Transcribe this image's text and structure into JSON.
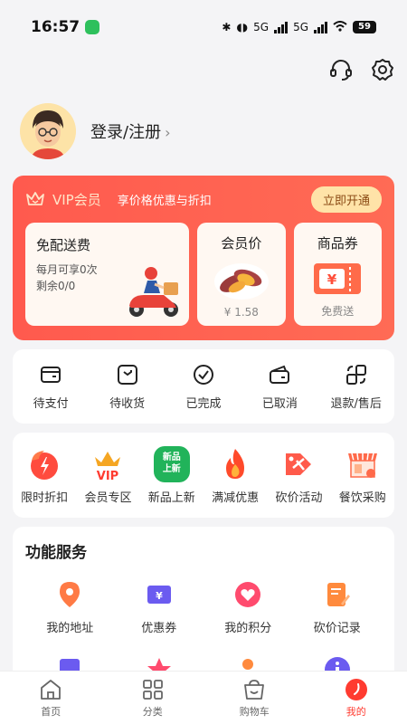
{
  "status": {
    "time": "16:57",
    "battery": "59",
    "net1": "5G",
    "net2": "5G"
  },
  "profile": {
    "login_text": "登录/注册",
    "chevron": "›"
  },
  "vip": {
    "title": "VIP会员",
    "subtitle": "享价格优惠与折扣",
    "button": "立即开通",
    "free_delivery": {
      "title": "免配送费",
      "line1": "每月可享0次",
      "line2": "剩余0/0"
    },
    "member_price": {
      "title": "会员价",
      "price": "¥ 1.58"
    },
    "coupon": {
      "title": "商品券",
      "note": "免费送"
    },
    "colors": {
      "accent": "#ff5a4e",
      "button_bg": "#ffe3a8"
    }
  },
  "orders": [
    {
      "label": "待支付",
      "icon": "wallet-icon"
    },
    {
      "label": "待收货",
      "icon": "package-icon"
    },
    {
      "label": "已完成",
      "icon": "check-circle-icon"
    },
    {
      "label": "已取消",
      "icon": "cancelled-wallet-icon"
    },
    {
      "label": "退款/售后",
      "icon": "refund-icon"
    }
  ],
  "activities": [
    {
      "label": "限时折扣",
      "icon": "flash-sale-icon"
    },
    {
      "label": "会员专区",
      "icon": "vip-crown-icon"
    },
    {
      "label": "新品上新",
      "icon": "new-badge-icon",
      "badge_line1": "新品",
      "badge_line2": "上新"
    },
    {
      "label": "满减优惠",
      "icon": "flame-icon"
    },
    {
      "label": "砍价活动",
      "icon": "bargain-tag-icon"
    },
    {
      "label": "餐饮采购",
      "icon": "storefront-icon"
    }
  ],
  "services": {
    "title": "功能服务",
    "items": [
      {
        "label": "我的地址",
        "icon": "location-pin-icon"
      },
      {
        "label": "优惠券",
        "icon": "coupon-icon"
      },
      {
        "label": "我的积分",
        "icon": "heart-points-icon"
      },
      {
        "label": "砍价记录",
        "icon": "notepad-icon"
      }
    ]
  },
  "tabbar": [
    {
      "label": "首页",
      "icon": "home-icon"
    },
    {
      "label": "分类",
      "icon": "grid-icon"
    },
    {
      "label": "购物车",
      "icon": "cart-icon"
    },
    {
      "label": "我的",
      "icon": "profile-icon",
      "active": true
    }
  ]
}
